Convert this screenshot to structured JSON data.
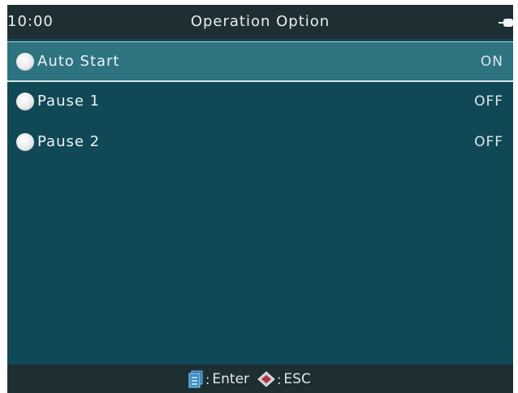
{
  "status_bar": {
    "time": "10:00",
    "title": "Operation Option",
    "power_icon": "plug-icon"
  },
  "menu": {
    "selected_index": 0,
    "items": [
      {
        "label": "Auto Start",
        "value": "ON"
      },
      {
        "label": "Pause 1",
        "value": "OFF"
      },
      {
        "label": "Pause 2",
        "value": "OFF"
      }
    ]
  },
  "bottom_bar": {
    "enter_icon": "enter-icon",
    "enter_label": "Enter",
    "esc_icon": "esc-icon",
    "esc_label": "ESC"
  },
  "colors": {
    "background": "#104856",
    "bar": "#1e2f34",
    "selected_row": "#2d7380",
    "enter_icon": "#3a8fc4",
    "esc_icon": "#b3303a"
  }
}
